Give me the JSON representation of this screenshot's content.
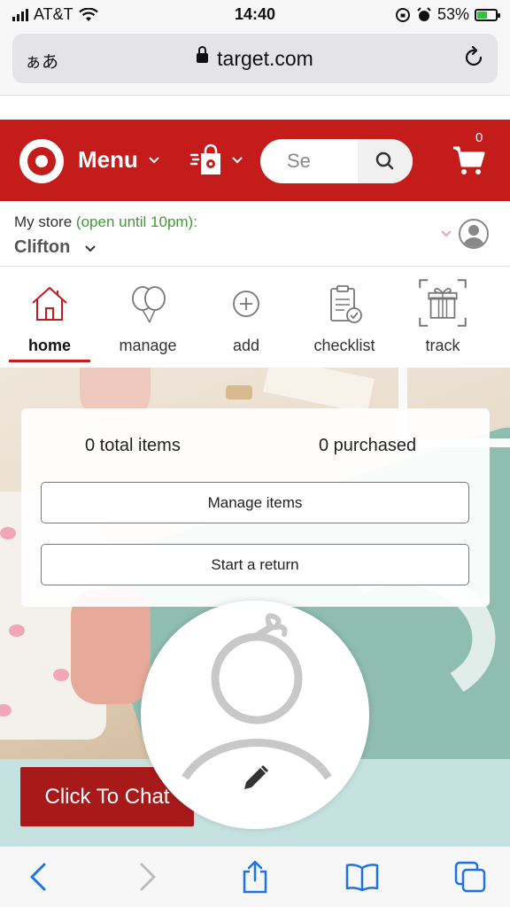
{
  "status_bar": {
    "carrier": "AT&T",
    "time": "14:40",
    "battery": "53%",
    "battery_level": 0.53
  },
  "browser": {
    "text_size_label": "ぁあ",
    "url": "target.com"
  },
  "header": {
    "menu_label": "Menu",
    "search_placeholder": "Se",
    "cart_count": "0"
  },
  "store": {
    "prefix": "My store",
    "open_text": "(open until 10pm):",
    "name": "Clifton"
  },
  "nav": {
    "items": [
      {
        "label": "home"
      },
      {
        "label": "manage"
      },
      {
        "label": "add"
      },
      {
        "label": "checklist"
      },
      {
        "label": "track"
      }
    ],
    "active": "home"
  },
  "registry": {
    "total_items": "0 total items",
    "purchased": "0 purchased",
    "manage_button": "Manage items",
    "return_button": "Start a return"
  },
  "chat": {
    "label": "Click To Chat"
  },
  "colors": {
    "brand_red": "#c41b1b",
    "chat_red": "#a81a1a",
    "open_green": "#3d9b35",
    "ios_blue": "#1a73e8"
  }
}
